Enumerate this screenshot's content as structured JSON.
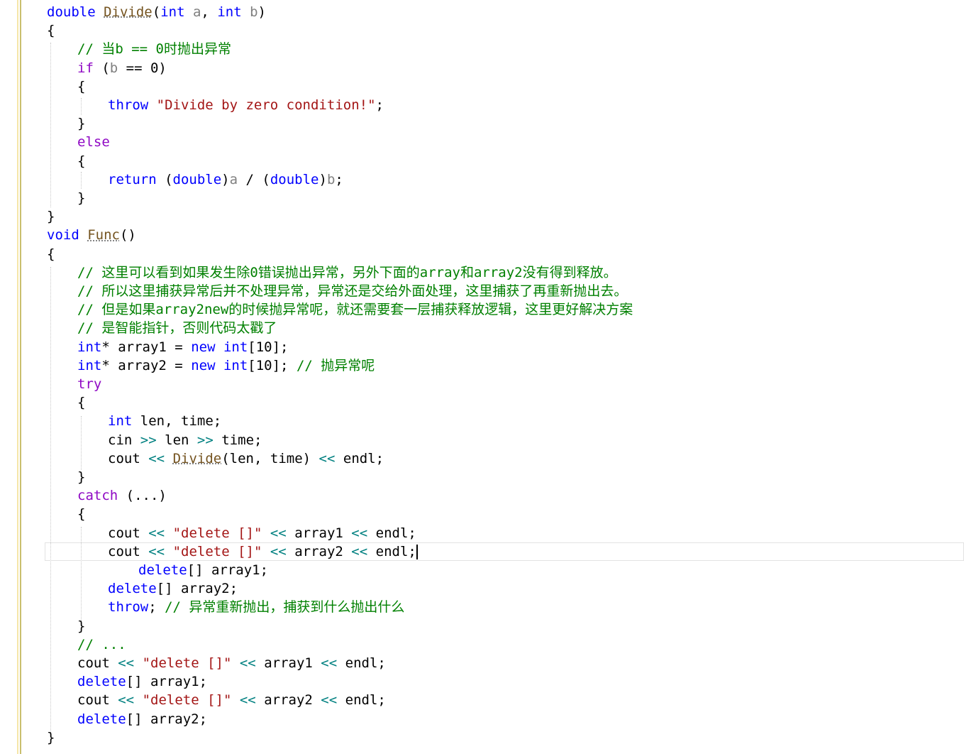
{
  "editor": {
    "language": "cpp",
    "colors": {
      "keyword": "#0000ff",
      "control_keyword": "#8f08c4",
      "string": "#a31515",
      "comment": "#008000",
      "function": "#74531f",
      "parameter": "#808080",
      "text": "#000000"
    },
    "current_line_number": 30,
    "lines": [
      "double Divide(int a, int b)",
      "{",
      "    // 当b == 0时抛出异常",
      "    if (b == 0)",
      "    {",
      "        throw \"Divide by zero condition!\";",
      "    }",
      "    else",
      "    {",
      "        return (double)a / (double)b;",
      "    }",
      "}",
      "void Func()",
      "{",
      "    // 这里可以看到如果发生除0错误抛出异常，另外下面的array和array2没有得到释放。",
      "    // 所以这里捕获异常后并不处理异常，异常还是交给外面处理，这里捕获了再重新抛出去。",
      "    // 但是如果array2new的时候抛异常呢，就还需要套一层捕获释放逻辑，这里更好解决方案",
      "    // 是智能指针，否则代码太戳了",
      "    int* array1 = new int[10];",
      "    int* array2 = new int[10]; // 抛异常呢",
      "    try",
      "    {",
      "        int len, time;",
      "        cin >> len >> time;",
      "        cout << Divide(len, time) << endl;",
      "    }",
      "    catch (...)",
      "    {",
      "        cout << \"delete []\" << array1 << endl;",
      "        cout << \"delete []\" << array2 << endl;",
      "            delete[] array1;",
      "        delete[] array2;",
      "        throw; // 异常重新抛出，捕获到什么抛出什么",
      "    }",
      "    // ...",
      "    cout << \"delete []\" << array1 << endl;",
      "    delete[] array1;",
      "    cout << \"delete []\" << array2 << endl;",
      "    delete[] array2;",
      "}"
    ]
  }
}
